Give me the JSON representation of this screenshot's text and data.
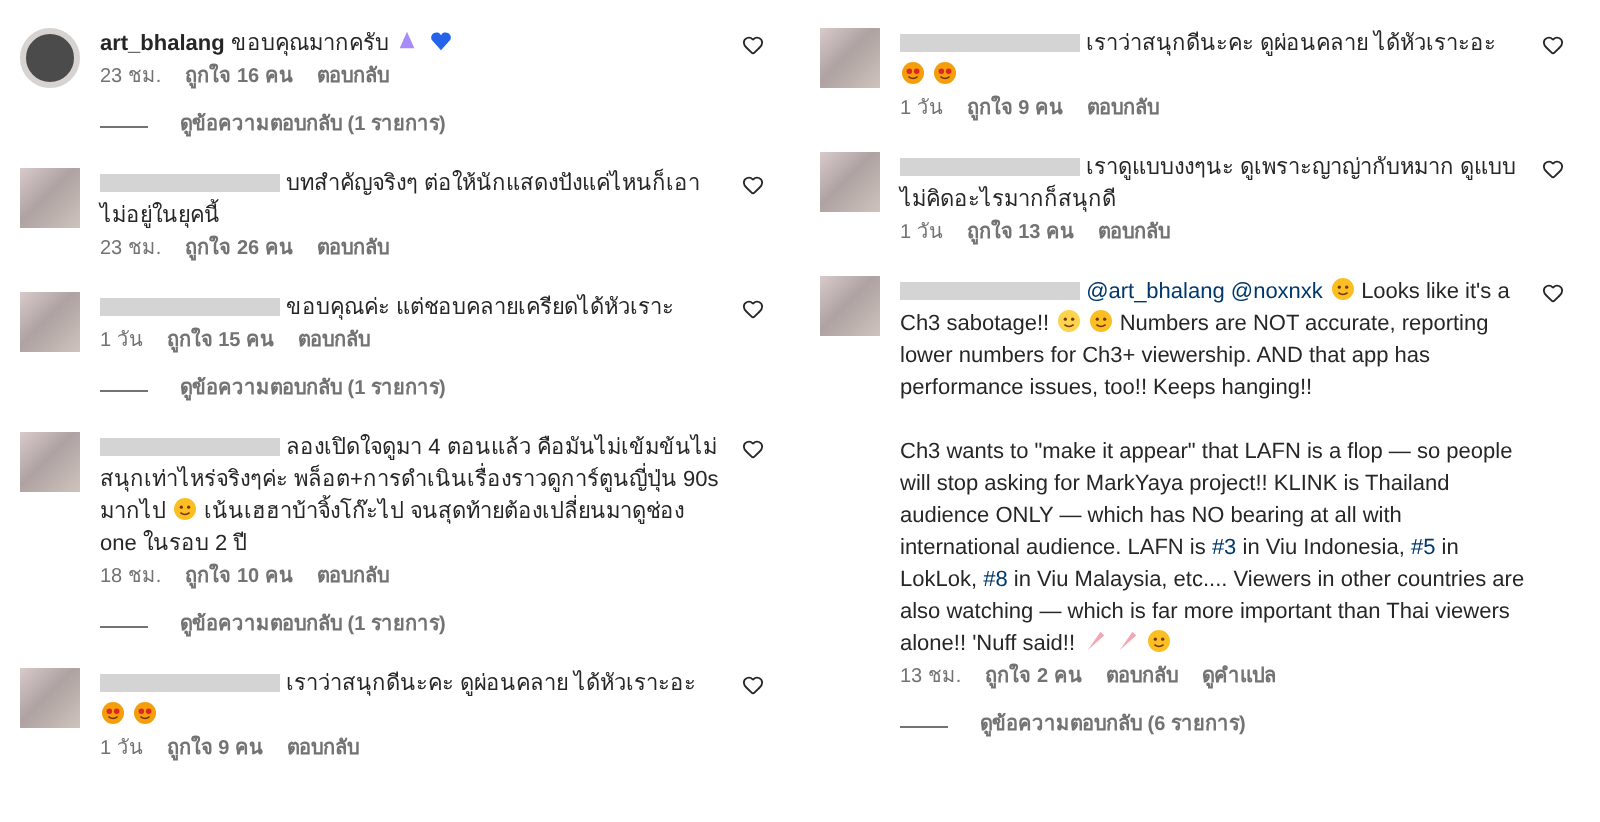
{
  "columns": [
    {
      "comments": [
        {
          "username": "art_bhalang",
          "text": [
            {
              "kind": "text",
              "text": "ขอบคุณมากครับ"
            },
            {
              "kind": "pray"
            },
            {
              "kind": "heart"
            }
          ],
          "time": "23 ชม.",
          "likes": "ถูกใจ 16 คน",
          "actions": [
            "ตอบกลับ"
          ],
          "replies": "ดูข้อความตอบกลับ (1 รายการ)"
        },
        {
          "text": [
            {
              "kind": "text",
              "text": "บทสำคัญจริงๆ ต่อให้นักแสดงปังแค่ไหนก็เอาไม่อยู่ในยุคนี้"
            }
          ],
          "time": "23 ชม.",
          "likes": "ถูกใจ 26 คน",
          "actions": [
            "ตอบกลับ"
          ]
        },
        {
          "text": [
            {
              "kind": "text",
              "text": "ขอบคุณค่ะ แต่ชอบคลายเครียดได้หัวเราะ"
            }
          ],
          "time": "1 วัน",
          "likes": "ถูกใจ 15 คน",
          "actions": [
            "ตอบกลับ"
          ],
          "replies": "ดูข้อความตอบกลับ (1 รายการ)"
        },
        {
          "text": [
            {
              "kind": "text",
              "text": "ลองเปิดใจดูมา 4 ตอนแล้ว คือมันไม่เข้มข้นไม่สนุกเท่าไหร่จริงๆค่ะ พล็อต+การดำเนินเรื่องราวดูการ์ตูนญี่ปุ่น 90s มากไป"
            },
            {
              "kind": "sweat_smile"
            },
            {
              "kind": "text",
              "text": "เน้นเฮฮาบ้าจิ้งโก๊ะไป จนสุดท้ายต้องเปลี่ยนมาดูช่อง one ในรอบ 2 ปี"
            }
          ],
          "time": "18 ชม.",
          "likes": "ถูกใจ 10 คน",
          "actions": [
            "ตอบกลับ"
          ],
          "replies": "ดูข้อความตอบกลับ (1 รายการ)"
        },
        {
          "text": [
            {
              "kind": "text",
              "text": "เราว่าสนุกดีนะคะ ดูผ่อนคลาย ได้หัวเราะอะ"
            },
            {
              "kind": "heart_eyes"
            },
            {
              "kind": "heart_eyes"
            }
          ],
          "time": "1 วัน",
          "likes": "ถูกใจ 9 คน",
          "actions": [
            "ตอบกลับ"
          ]
        }
      ]
    },
    {
      "comments": [
        {
          "text": [
            {
              "kind": "text",
              "text": "เราว่าสนุกดีนะคะ ดูผ่อนคลาย ได้หัวเราะอะ"
            },
            {
              "kind": "heart_eyes"
            },
            {
              "kind": "heart_eyes"
            }
          ],
          "time": "1 วัน",
          "likes": "ถูกใจ 9 คน",
          "actions": [
            "ตอบกลับ"
          ]
        },
        {
          "text": [
            {
              "kind": "text",
              "text": "เราดูแบบงงๆนะ ดูเพราะญาญ่ากับหมาก ดูแบบไม่คิดอะไรมากก็สนุกดี"
            }
          ],
          "time": "1 วัน",
          "likes": "ถูกใจ 13 คน",
          "actions": [
            "ตอบกลับ"
          ]
        },
        {
          "text": [
            {
              "kind": "mention",
              "text": "@art_bhalang"
            },
            {
              "kind": "mention",
              "text": "@noxnxk"
            },
            {
              "kind": "monocle"
            },
            {
              "kind": "text",
              "text": "Looks like it's a Ch3 sabotage!!"
            },
            {
              "kind": "flushed"
            },
            {
              "kind": "screaming"
            },
            {
              "kind": "text",
              "text": "Numbers are NOT accurate, reporting lower numbers for Ch3+ viewership. AND that app has performance issues, too!! Keeps hanging!!"
            },
            {
              "kind": "break"
            },
            {
              "kind": "text",
              "text": "Ch3 wants to \"make it appear\" that LAFN is a flop — so people will stop asking for MarkYaya project!! KLINK is Thailand audience ONLY — which has NO bearing at all with international audience. LAFN is"
            },
            {
              "kind": "hashtag",
              "text": "#3"
            },
            {
              "kind": "text",
              "text": "in Viu Indonesia,"
            },
            {
              "kind": "hashtag",
              "text": "#5"
            },
            {
              "kind": "text",
              "text": "in LokLok,"
            },
            {
              "kind": "hashtag",
              "text": "#8"
            },
            {
              "kind": "text",
              "text": "in Viu Malaysia, etc.... Viewers in other countries are also watching — which is far more important than Thai viewers alone!! 'Nuff said!!"
            },
            {
              "kind": "party"
            },
            {
              "kind": "party"
            },
            {
              "kind": "smirk"
            }
          ],
          "time": "13 ชม.",
          "likes": "ถูกใจ 2 คน",
          "actions": [
            "ตอบกลับ",
            "ดูคำแปล"
          ],
          "replies": "ดูข้อความตอบกลับ (6 รายการ)"
        }
      ]
    }
  ]
}
